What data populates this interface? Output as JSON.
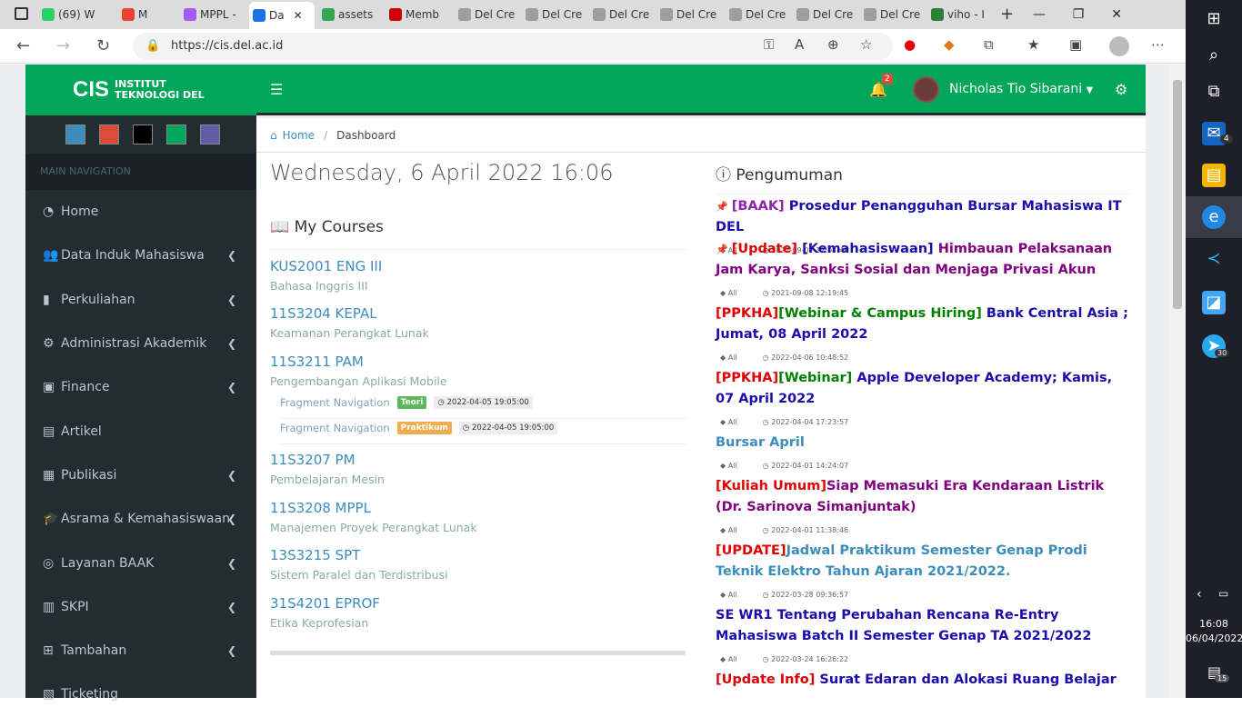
{
  "browser": {
    "tabs": [
      {
        "label": "(69) W",
        "favicon_color": "#25d366"
      },
      {
        "label": "M",
        "favicon_color": "#ea4335"
      },
      {
        "label": "MPPL -",
        "favicon_color": "#a259ff"
      },
      {
        "label": "Da",
        "favicon_color": "#1a73e8",
        "active": true
      },
      {
        "label": "assets",
        "favicon_color": "#34a853"
      },
      {
        "label": "Memb",
        "favicon_color": "#cc0000"
      },
      {
        "label": "Del Cre",
        "favicon_color": "#9e9e9e"
      },
      {
        "label": "Del Cre",
        "favicon_color": "#9e9e9e"
      },
      {
        "label": "Del Cre",
        "favicon_color": "#9e9e9e"
      },
      {
        "label": "Del Cre",
        "favicon_color": "#9e9e9e"
      },
      {
        "label": "Del Cre",
        "favicon_color": "#9e9e9e"
      },
      {
        "label": "Del Cre",
        "favicon_color": "#9e9e9e"
      },
      {
        "label": "Del Cre",
        "favicon_color": "#9e9e9e"
      },
      {
        "label": "viho - I",
        "favicon_color": "#2e7d32"
      }
    ],
    "url": "https://cis.del.ac.id"
  },
  "app": {
    "logo_big": "CIS",
    "logo_line1": "INSTITUT",
    "logo_line2": "TEKNOLOGI DEL",
    "accent_color": "#00a65a",
    "swatches": [
      "#3c8dbc",
      "#dd4b39",
      "#000000",
      "#00a65a",
      "#605ca8"
    ],
    "nav_header": "MAIN NAVIGATION",
    "nav": [
      {
        "label": "Home",
        "icon": "tachometer-icon",
        "chevron": false
      },
      {
        "label": "Data Induk Mahasiswa",
        "icon": "users-icon",
        "chevron": true
      },
      {
        "label": "Perkuliahan",
        "icon": "book-icon",
        "chevron": true
      },
      {
        "label": "Administrasi Akademik",
        "icon": "cogs-icon",
        "chevron": true
      },
      {
        "label": "Finance",
        "icon": "money-icon",
        "chevron": true
      },
      {
        "label": "Artikel",
        "icon": "file-icon",
        "chevron": false
      },
      {
        "label": "Publikasi",
        "icon": "newspaper-icon",
        "chevron": true
      },
      {
        "label": "Asrama & Kemahasiswaan",
        "icon": "graduation-cap-icon",
        "chevron": true
      },
      {
        "label": "Layanan BAAK",
        "icon": "comments-icon",
        "chevron": true
      },
      {
        "label": "SKPI",
        "icon": "archive-icon",
        "chevron": true
      },
      {
        "label": "Tambahan",
        "icon": "plus-square-icon",
        "chevron": true
      },
      {
        "label": "Ticketing",
        "icon": "ticket-icon",
        "chevron": false
      }
    ],
    "notification_count": "2",
    "user_name": "Nicholas Tio Sibarani"
  },
  "breadcrumb": {
    "home": "Home",
    "current": "Dashboard"
  },
  "date_heading": "Wednesday, 6 April 2022 16:06",
  "courses_title": "My Courses",
  "courses": [
    {
      "code": "KUS2001 ENG III",
      "name": "Bahasa Inggris III"
    },
    {
      "code": "11S3204 KEPAL",
      "name": "Keamanan Perangkat Lunak"
    },
    {
      "code": "11S3211 PAM",
      "name": "Pengembangan Aplikasi Mobile"
    },
    {
      "code": "11S3207 PM",
      "name": "Pembelajaran Mesin"
    },
    {
      "code": "11S3208 MPPL",
      "name": "Manajemen Proyek Perangkat Lunak"
    },
    {
      "code": "13S3215 SPT",
      "name": "Sistem Paralel dan Terdistribusi"
    },
    {
      "code": "31S4201 EPROF",
      "name": "Etika Keprofesian"
    }
  ],
  "fragments": [
    {
      "label": "Fragment Navigation",
      "tag": "Teori",
      "tag_color": "#5cb85c",
      "time": "2022-04-05 19:05:00"
    },
    {
      "label": "Fragment Navigation",
      "tag": "Praktikum",
      "tag_color": "#f0ad4e",
      "time": "2022-04-05 19:05:00"
    }
  ],
  "announcements_title": "Pengumuman",
  "announcements": [
    {
      "pinned": true,
      "parts": [
        {
          "t": "[BAAK] ",
          "c": "#8e24aa"
        },
        {
          "t": "Prosedur Penangguhan Bursar Mahasiswa IT DEL",
          "c": "#1a0dab"
        }
      ],
      "audience": "All",
      "time": "2021-09-07 12:04:48"
    },
    {
      "pinned": true,
      "parts": [
        {
          "t": "[Update] ",
          "c": "#e00000"
        },
        {
          "t": "[Kemahasiswaan] ",
          "c": "#1a0dab"
        },
        {
          "t": "Himbauan Pelaksanaan Jam Karya, Sanksi Sosial dan Menjaga Privasi Akun",
          "c": "#800080"
        }
      ],
      "audience": "All",
      "time": "2021-09-08 12:19:45"
    },
    {
      "pinned": false,
      "parts": [
        {
          "t": "[PPKHA]",
          "c": "#e00000"
        },
        {
          "t": "[Webinar & Campus Hiring] ",
          "c": "#008000"
        },
        {
          "t": "Bank Central Asia ; Jumat, 08 April 2022",
          "c": "#1a0dab"
        }
      ],
      "audience": "All",
      "time": "2022-04-06 10:48:52"
    },
    {
      "pinned": false,
      "parts": [
        {
          "t": "[PPKHA]",
          "c": "#e00000"
        },
        {
          "t": "[Webinar] ",
          "c": "#008000"
        },
        {
          "t": "Apple Developer Academy; Kamis, 07 April 2022",
          "c": "#1a0dab"
        }
      ],
      "audience": "All",
      "time": "2022-04-04 17:23:57"
    },
    {
      "pinned": false,
      "parts": [
        {
          "t": "Bursar April",
          "c": "#3c8dbc"
        }
      ],
      "audience": "All",
      "time": "2022-04-01 14:24:07"
    },
    {
      "pinned": false,
      "parts": [
        {
          "t": "[Kuliah Umum]",
          "c": "#e00000"
        },
        {
          "t": "Siap Memasuki Era Kendaraan Listrik (Dr. Sarinova Simanjuntak)",
          "c": "#800080"
        }
      ],
      "audience": "All",
      "time": "2022-04-01 11:38:46"
    },
    {
      "pinned": false,
      "parts": [
        {
          "t": "[UPDATE]",
          "c": "#e00000"
        },
        {
          "t": "Jadwal Praktikum Semester Genap Prodi Teknik Elektro Tahun Ajaran 2021/2022.",
          "c": "#3c8dbc"
        }
      ],
      "audience": "All",
      "time": "2022-03-28 09:36:57"
    },
    {
      "pinned": false,
      "parts": [
        {
          "t": "SE WR1 Tentang Perubahan Rencana Re-Entry Mahasiswa Batch II Semester Genap TA 2021/2022",
          "c": "#1a0dab"
        }
      ],
      "audience": "All",
      "time": "2022-03-24 16:26:22"
    },
    {
      "pinned": false,
      "parts": [
        {
          "t": "[Update Info] ",
          "c": "#e00000"
        },
        {
          "t": "Surat Edaran dan Alokasi Ruang Belajar",
          "c": "#1a0dab"
        }
      ],
      "audience": "All",
      "time": ""
    }
  ],
  "taskbar": {
    "time": "16:08",
    "date": "06/04/2022",
    "mail_badge": "4",
    "telegram_badge": "30",
    "notif_badge": "15"
  }
}
